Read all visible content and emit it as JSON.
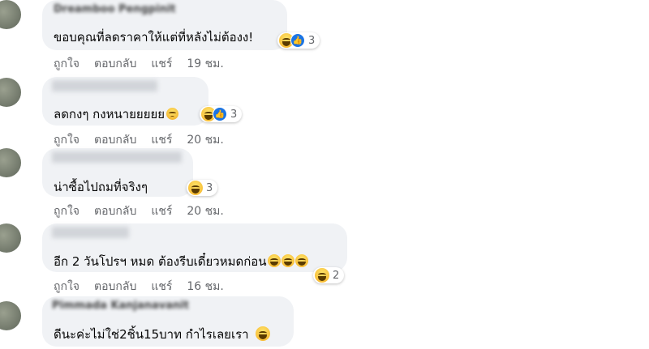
{
  "comments": [
    {
      "author": "Dreamboo Pengpinit",
      "text": "ขอบคุณที่ลดราคาให้แต่ที่หลังไม่ต้องง!",
      "reaction_count": "3",
      "actions": {
        "like": "ถูกใจ",
        "reply": "ตอบกลับ",
        "share": "แชร์",
        "time": "19 ชม."
      }
    },
    {
      "author": "",
      "text": "ลดกงๆ กงหนายยยยย",
      "reaction_count": "3",
      "actions": {
        "like": "ถูกใจ",
        "reply": "ตอบกลับ",
        "share": "แชร์",
        "time": "20 ชม."
      }
    },
    {
      "author": "",
      "text": "น่าซื้อไปถมที่จริงๆ",
      "reaction_count": "3",
      "actions": {
        "like": "ถูกใจ",
        "reply": "ตอบกลับ",
        "share": "แชร์",
        "time": "20 ชม."
      }
    },
    {
      "author": "",
      "text": "อีก 2 วันโปรฯ หมด ต้องรีบเดี๋ยวหมดก่อน",
      "reaction_count": "2",
      "actions": {
        "like": "ถูกใจ",
        "reply": "ตอบกลับ",
        "share": "แชร์",
        "time": "16 ชม."
      }
    },
    {
      "author": "Pimmada Kanjanavanit",
      "text": "ดีนะค่ะไม่ใช่2ชิ้น15บาท กำไรเลยเรา",
      "reaction_count": ""
    }
  ],
  "icons": {
    "haha": "haha-reaction-icon",
    "like": "like-reaction-icon",
    "sad": "sad-emoji-icon"
  },
  "colors": {
    "bubble": "#f0f2f5",
    "meta_text": "#65676b",
    "like_blue": "#1b74e4",
    "haha_yellow": "#f7b125"
  }
}
